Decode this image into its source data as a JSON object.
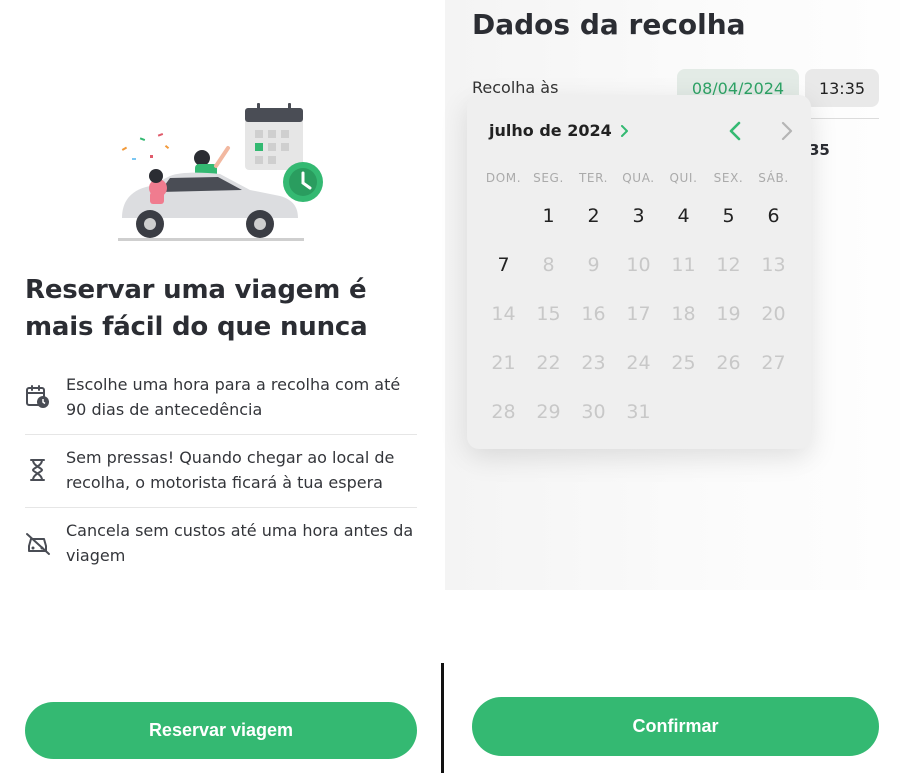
{
  "left": {
    "headline": "Reservar uma viagem é mais fácil do que nunca",
    "features": [
      {
        "icon": "calendar-clock-icon",
        "text": "Escolhe uma hora para a recolha com até 90 dias de antecedência"
      },
      {
        "icon": "hourglass-icon",
        "text": "Sem pressas! Quando chegar ao local de recolha, o motorista ficará à tua espera"
      },
      {
        "icon": "car-cancel-icon",
        "text": "Cancela sem custos até uma hora antes da viagem"
      }
    ],
    "button_label": "Reservar viagem"
  },
  "right": {
    "title": "Dados da recolha",
    "pickup_label": "Recolha às",
    "date_value": "08/04/2024",
    "time_value": "13:35",
    "peek_text": "35",
    "calendar": {
      "month_label": "julho de 2024",
      "weekdays": [
        "DOM.",
        "SEG.",
        "TER.",
        "QUA.",
        "QUI.",
        "SEX.",
        "SÁB."
      ],
      "weeks": [
        [
          "",
          "1",
          "2",
          "3",
          "4",
          "5",
          "6"
        ],
        [
          "7",
          "8",
          "9",
          "10",
          "11",
          "12",
          "13"
        ],
        [
          "14",
          "15",
          "16",
          "17",
          "18",
          "19",
          "20"
        ],
        [
          "21",
          "22",
          "23",
          "24",
          "25",
          "26",
          "27"
        ],
        [
          "28",
          "29",
          "30",
          "31",
          "",
          "",
          ""
        ]
      ],
      "enabled_days": [
        "1",
        "2",
        "3",
        "4",
        "5",
        "6",
        "7"
      ]
    },
    "button_label": "Confirmar"
  },
  "colors": {
    "accent": "#34b972",
    "accent_text": "#2ea366",
    "title": "#2b2d33",
    "disabled_day": "#c8c8c8"
  }
}
